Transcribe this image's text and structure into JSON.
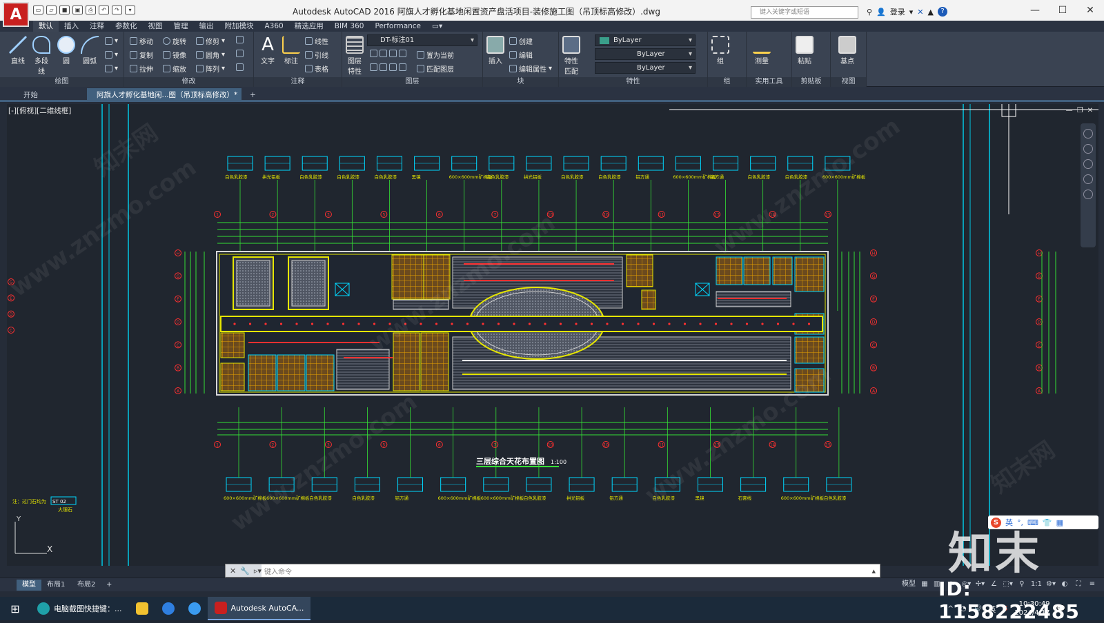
{
  "titlebar": {
    "app_logo": "A",
    "title": "Autodesk AutoCAD 2016      阿旗人才孵化基地闲置资产盘活项目-装修施工图（吊顶标高修改）.dwg",
    "search_placeholder": "键入关键字或短语",
    "login": "登录"
  },
  "ribbon_tabs": [
    "默认",
    "插入",
    "注释",
    "参数化",
    "视图",
    "管理",
    "输出",
    "附加模块",
    "A360",
    "精选应用",
    "BIM 360",
    "Performance"
  ],
  "ribbon": {
    "draw": {
      "label": "绘图",
      "line": "直线",
      "polyline": "多段线",
      "circle": "圆",
      "arc": "圆弧"
    },
    "modify": {
      "label": "修改",
      "move": "移动",
      "rotate": "旋转",
      "trim": "修剪",
      "copy": "复制",
      "mirror": "镜像",
      "fillet": "圆角",
      "stretch": "拉伸",
      "scale": "缩放",
      "array": "阵列"
    },
    "annotation": {
      "label": "注释",
      "text": "文字",
      "dim": "标注",
      "leader": "引线",
      "linear": "线性",
      "table": "表格"
    },
    "layers": {
      "label": "图层",
      "layer_props": "图层特性",
      "current_layer": "DT-标注01",
      "set_current": "置为当前",
      "match_layer": "匹配图层"
    },
    "block": {
      "label": "块",
      "insert": "插入",
      "create": "创建",
      "edit": "编辑",
      "edit_attr": "编辑属性"
    },
    "properties": {
      "label": "特性",
      "match": "特性匹配",
      "color": "ByLayer",
      "linetype": "ByLayer",
      "lineweight": "ByLayer"
    },
    "groups": {
      "label": "组",
      "group": "组"
    },
    "utilities": {
      "label": "实用工具",
      "measure": "测量"
    },
    "clipboard": {
      "label": "剪贴板",
      "paste": "粘贴"
    },
    "view": {
      "label": "视图",
      "base": "基点"
    }
  },
  "file_tabs": {
    "start": "开始",
    "active": "阿旗人才孵化基地闲...图（吊顶标高修改）*"
  },
  "canvas": {
    "view_label": "[-][俯视][二维线框]",
    "drawing_title": "三层综合天花布置图",
    "drawing_scale": "1:100",
    "side_note": "注：过门石均为",
    "side_note_code": "ST 02",
    "side_note_text": "大理石",
    "axis_numbers": [
      "1",
      "2",
      "3",
      "5",
      "6",
      "7",
      "10",
      "10",
      "11",
      "13",
      "14",
      "15"
    ],
    "axis_letters": [
      "H",
      "G",
      "E",
      "D",
      "C",
      "B",
      "A"
    ],
    "top_labels": [
      "白色乳胶漆",
      "拱光铝板",
      "白色乳胶漆",
      "白色乳胶漆",
      "白色乳胶漆",
      "黑镜",
      "600×600mm矿棉板",
      "白色乳胶漆",
      "拱光铝板",
      "白色乳胶漆",
      "白色乳胶漆",
      "铝方通",
      "600×600mm矿棉板",
      "铝方通",
      "白色乳胶漆",
      "白色乳胶漆",
      "600×600mm矿棉板"
    ],
    "bottom_labels": [
      "600×600mm矿棉板",
      "600×600mm矿棉板",
      "白色乳胶漆",
      "白色乳胶漆",
      "铝方通",
      "600×600mm矿棉板",
      "600×600mm矿棉板",
      "白色乳胶漆",
      "拱光铝板",
      "铝方通",
      "白色乳胶漆",
      "黑镜",
      "石膏线",
      "600×600mm矿棉板",
      "白色乳胶漆"
    ]
  },
  "watermark": {
    "site": "www.znzmo.com",
    "brand": "知末",
    "brand_small": "知末网",
    "id": "ID: 1158222485"
  },
  "ime": {
    "lang": "英"
  },
  "cmdline": {
    "prompt": "键入命令"
  },
  "layout_tabs": [
    "模型",
    "布局1",
    "布局2"
  ],
  "status": {
    "model": "模型",
    "scale": "1:1"
  },
  "taskbar": {
    "items": [
      "电脑截图快捷键：...",
      "",
      "",
      "",
      "Autodesk AutoCA..."
    ],
    "time": "10:30:49",
    "date": "2024/4/17",
    "lang": "英"
  },
  "colors": {
    "accent": "#41607e",
    "cad_bg": "#20262f",
    "green": "#35e035",
    "yellow": "#e6e600",
    "cyan": "#00d8ff",
    "red": "#ff3030"
  }
}
